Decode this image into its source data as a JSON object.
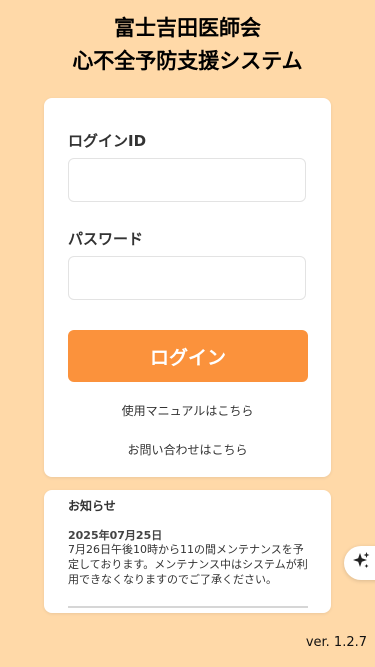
{
  "header": {
    "title_line1": "富士吉田医師会",
    "title_line2": "心不全予防支援システム"
  },
  "login_form": {
    "login_id_label": "ログインID",
    "login_id_value": "",
    "password_label": "パスワード",
    "password_value": "",
    "login_button_label": "ログイン",
    "manual_link": "使用マニュアルはこちら",
    "contact_link": "お問い合わせはこちら"
  },
  "notice": {
    "heading": "お知らせ",
    "date": "2025年07月25日",
    "body": "7月26日午後10時から11の間メンテナンスを予定しております。メンテナンス中はシステムが利用できなくなりますのでご了承ください。"
  },
  "floating": {
    "icon": "sparkle-icon"
  },
  "footer": {
    "version": "ver. 1.2.7"
  },
  "colors": {
    "background": "#ffd9a8",
    "accent": "#fb923c",
    "card": "#ffffff"
  }
}
